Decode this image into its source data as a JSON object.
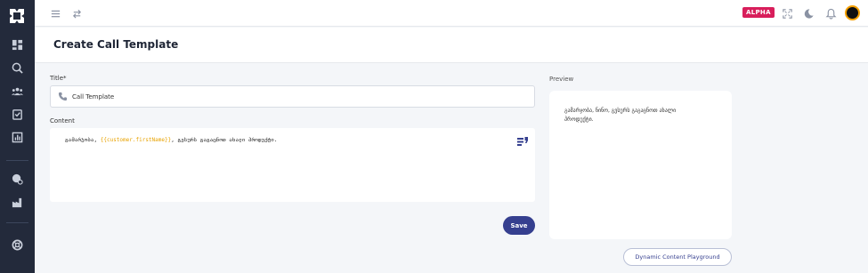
{
  "topbar": {
    "alpha_badge": "ALPHA",
    "accent": "#d81e5b"
  },
  "page": {
    "title": "Create Call Template"
  },
  "form": {
    "title_label": "Title*",
    "title_value": "Call Template",
    "content_label": "Content",
    "content": {
      "prefix": "გამარჯობა, ",
      "variable": "{{customer.firstName}}",
      "suffix": ", გვსურს გაგაცნოთ ახალი პროდუქტი."
    },
    "save_label": "Save"
  },
  "preview": {
    "label": "Preview",
    "text": "გამარჯობა, ნინო, გვსურს გაგაცნოთ ახალი პროდუქტი."
  },
  "playground_button": "Dynamic Content Playground",
  "colors": {
    "sidebar": "#232a3b",
    "primary": "#353f8f",
    "variable": "#e8a200"
  },
  "icons": {
    "sidebar": [
      "logo-icon",
      "dashboard-icon",
      "search-analytics-icon",
      "users-icon",
      "tasks-icon",
      "reports-icon",
      "location-icon",
      "factory-icon",
      "support-icon"
    ],
    "topbar": [
      "menu-icon",
      "swap-icon",
      "fullscreen-icon",
      "dark-mode-icon",
      "bell-icon"
    ]
  }
}
